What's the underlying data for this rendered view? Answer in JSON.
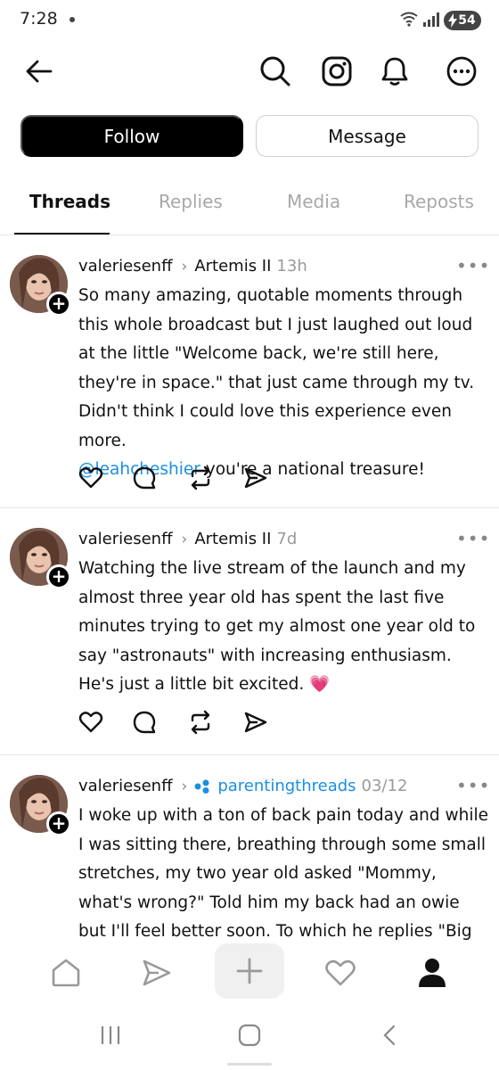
{
  "status_bar": {
    "time": "7:28",
    "battery": "54"
  },
  "profile_actions": {
    "follow_label": "Follow",
    "message_label": "Message"
  },
  "tabs": [
    {
      "label": "Threads",
      "active": true
    },
    {
      "label": "Replies",
      "active": false
    },
    {
      "label": "Media",
      "active": false
    },
    {
      "label": "Reposts",
      "active": false
    }
  ],
  "posts": [
    {
      "username": "valeriesenff",
      "topic": "Artemis II",
      "time": "13h",
      "more": "•••",
      "body_before_mention": "So many amazing, quotable moments through this whole broadcast but I just laughed out loud at the little \"Welcome back, we're still here, they're in space.\" that just came through my tv. Didn't think I could love this experience even more.",
      "mention": "@leahcheshier",
      "body_after_mention": " you're a national treasure!"
    },
    {
      "username": "valeriesenff",
      "topic": "Artemis II",
      "time": "7d",
      "more": "•••",
      "body": "Watching the live stream of the launch and my almost three year old has spent the last five minutes trying to get my almost one year old to say \"astronauts\" with increasing enthusiasm. He's just a little bit excited.",
      "emoji": "💗"
    },
    {
      "username": "valeriesenff",
      "topic": "parentingthreads",
      "time": "03/12",
      "more": "•••",
      "body": "I woke up with a ton of back pain today and while I was sitting there, breathing through some small stretches, my two year old asked \"Mommy, what's wrong?\" Told him my back had an owie but I'll feel better soon. To which he replies \"Big feelings"
    }
  ],
  "colors": {
    "link": "#1a8fe0",
    "follow_bg": "#000000",
    "muted": "#9a9a9a"
  }
}
